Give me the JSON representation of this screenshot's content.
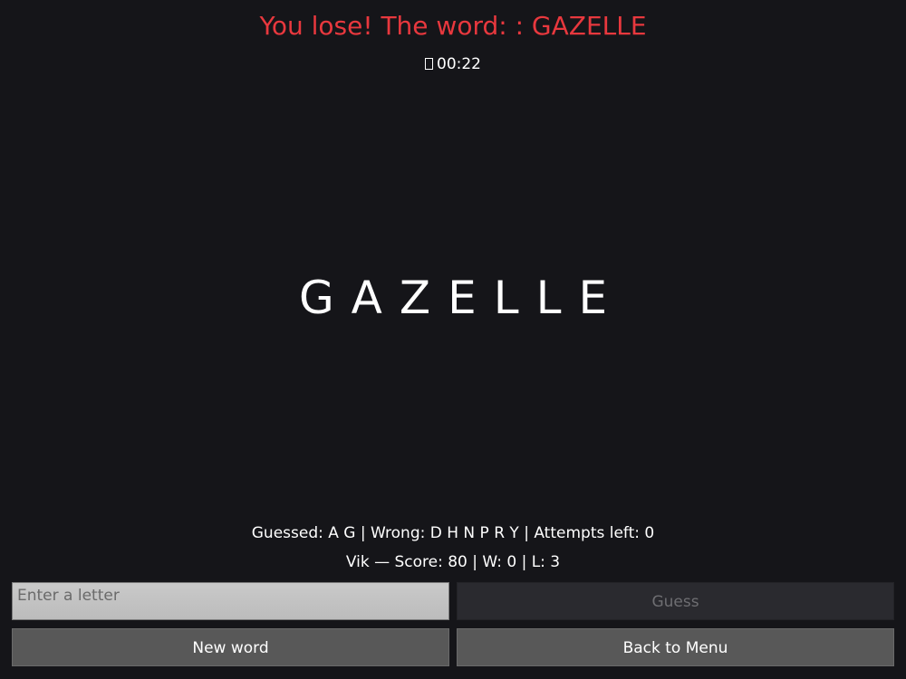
{
  "status": {
    "message": "You lose! The word: : GAZELLE",
    "color": "#e8383e"
  },
  "timer": {
    "icon": "clock-icon",
    "value": "00:22"
  },
  "word": {
    "display": "GAZELLE"
  },
  "progress": {
    "line": "Guessed: A G | Wrong: D H N P R Y | Attempts left: 0"
  },
  "player": {
    "line": "Vik — Score: 80 | W: 0 | L: 3"
  },
  "input": {
    "placeholder": "Enter a letter",
    "value": ""
  },
  "buttons": {
    "guess": "Guess",
    "new_word": "New word",
    "back_to_menu": "Back to Menu"
  }
}
